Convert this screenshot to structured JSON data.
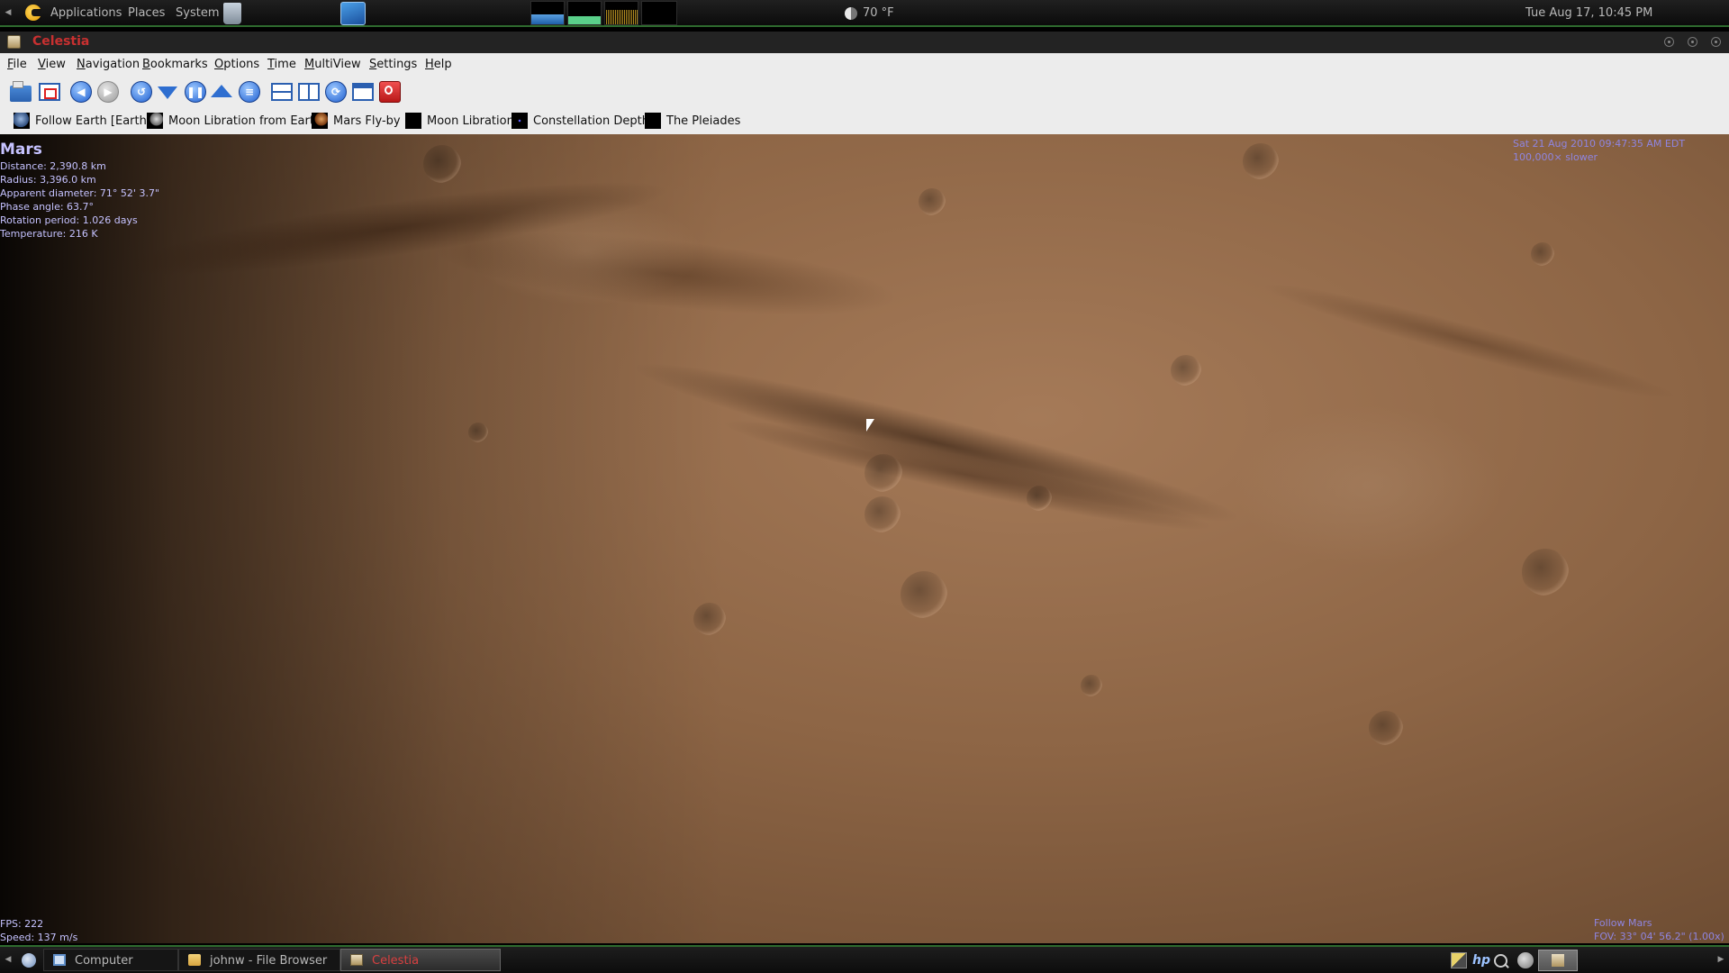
{
  "top_panel": {
    "menus": [
      "Applications",
      "Places",
      "System"
    ],
    "weather": "70 °F",
    "clock": "Tue Aug 17, 10:45 PM",
    "icons": [
      "gnome-foot-icon",
      "trash-icon",
      "display-settings-icon",
      "cpu-monitor-icon",
      "memory-monitor-icon",
      "network-monitor-icon",
      "load-monitor-icon",
      "weather-icon"
    ]
  },
  "window": {
    "title": "Celestia"
  },
  "menubar": {
    "items": [
      {
        "label": "File",
        "u": "F",
        "rest": "ile"
      },
      {
        "label": "View",
        "u": "V",
        "rest": "iew"
      },
      {
        "label": "Navigation",
        "u": "N",
        "rest": "avigation"
      },
      {
        "label": "Bookmarks",
        "u": "B",
        "rest": "ookmarks"
      },
      {
        "label": "Options",
        "u": "O",
        "rest": "ptions"
      },
      {
        "label": "Time",
        "u": "T",
        "rest": "ime"
      },
      {
        "label": "MultiView",
        "u": "M",
        "rest": "ultiView"
      },
      {
        "label": "Settings",
        "u": "S",
        "rest": "ettings"
      },
      {
        "label": "Help",
        "u": "H",
        "rest": "elp"
      }
    ]
  },
  "toolbar": {
    "icons": [
      "open-icon",
      "fullscreen-icon",
      "back-icon",
      "forward-icon",
      "home-icon",
      "time-reverse-icon",
      "pause-icon",
      "time-forward-icon",
      "real-time-icon",
      "split-horizontal-icon",
      "split-vertical-icon",
      "cycle-view-icon",
      "single-view-icon",
      "quit-icon"
    ]
  },
  "bookmarks": [
    {
      "label": "Follow Earth [Earth]",
      "thumb": "earth"
    },
    {
      "label": "Moon Libration from Earth",
      "thumb": "moon"
    },
    {
      "label": "Mars Fly-by",
      "thumb": "mars"
    },
    {
      "label": "Moon Libration",
      "thumb": "black"
    },
    {
      "label": "Constellation Depth",
      "thumb": "constellation"
    },
    {
      "label": "The Pleiades",
      "thumb": "black"
    }
  ],
  "hud": {
    "object_name": "Mars",
    "distance": "Distance: 2,390.8 km",
    "radius": "Radius: 3,396.0 km",
    "apparent_diameter": "Apparent diameter: 71° 52' 3.7\"",
    "phase_angle": "Phase angle: 63.7°",
    "rotation_period": "Rotation period: 1.026 days",
    "temperature": "Temperature: 216 K",
    "datetime": "Sat 21 Aug 2010 09:47:35 AM EDT",
    "time_rate": "100,000× slower",
    "fps": "FPS: 222",
    "speed": "Speed: 137 m/s",
    "follow": "Follow Mars",
    "fov": "FOV: 33° 04' 56.2\" (1.00x)"
  },
  "taskbar": {
    "tasks": [
      {
        "label": "Computer",
        "active": false
      },
      {
        "label": "johnw - File Browser",
        "active": false
      },
      {
        "label": "Celestia",
        "active": true
      }
    ]
  },
  "colors": {
    "panel_border": "#2e6a2e",
    "hud_text": "#c5c2ff",
    "title_text": "#c83030",
    "mars_surface": "#8d6545"
  }
}
